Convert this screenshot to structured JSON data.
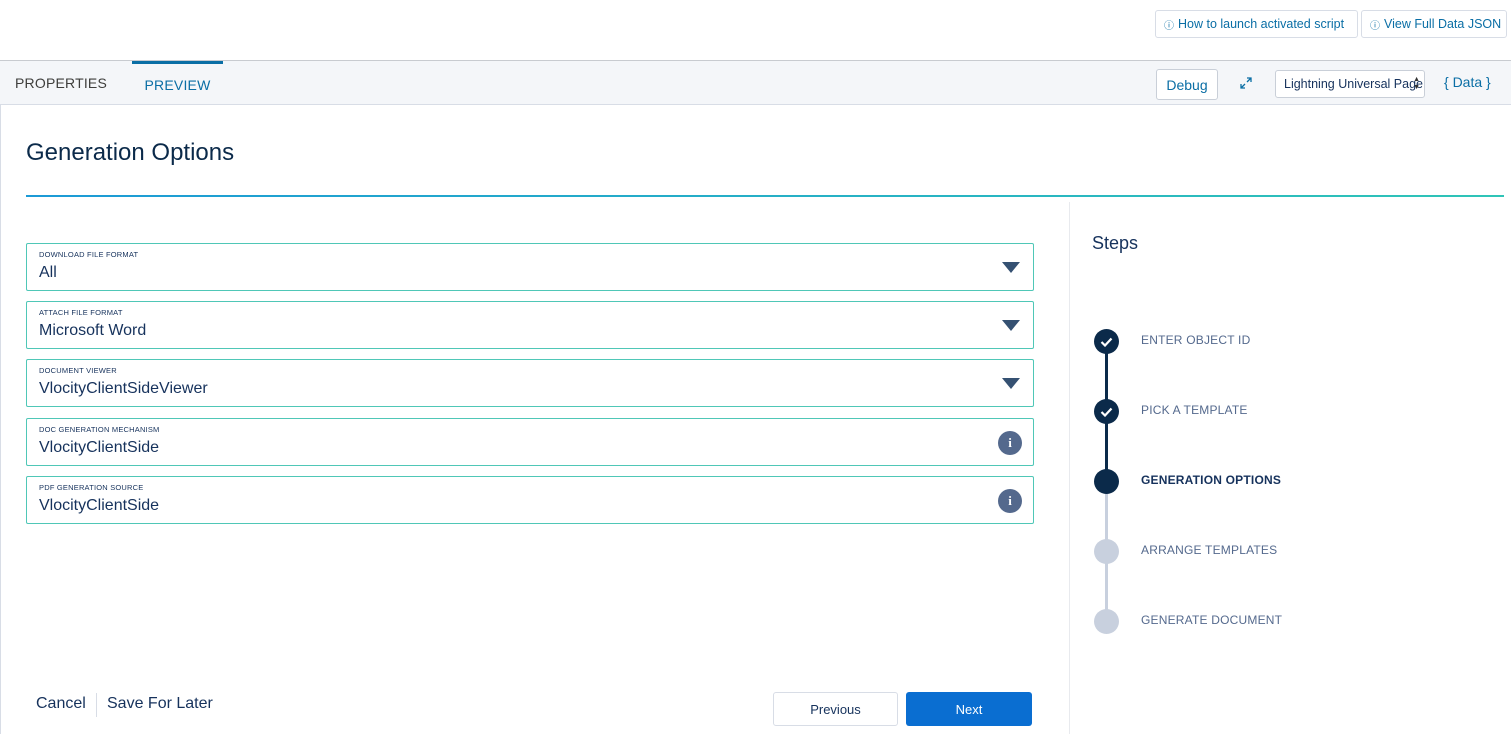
{
  "topbar": {
    "launch_label": "How to launch activated script",
    "json_label": "View Full Data JSON"
  },
  "tabs": [
    {
      "label": "PROPERTIES"
    },
    {
      "label": "PREVIEW"
    }
  ],
  "toolbar": {
    "debug_label": "Debug",
    "layout_select_value": "Lightning Universal Page",
    "data_label": "{ Data }"
  },
  "page": {
    "title": "Generation Options"
  },
  "fields": [
    {
      "label": "DOWNLOAD FILE FORMAT",
      "value": "All",
      "control": "dropdown"
    },
    {
      "label": "ATTACH FILE FORMAT",
      "value": "Microsoft Word",
      "control": "dropdown"
    },
    {
      "label": "DOCUMENT VIEWER",
      "value": "VlocityClientSideViewer",
      "control": "dropdown"
    },
    {
      "label": "DOC GENERATION MECHANISM",
      "value": "VlocityClientSide",
      "control": "info"
    },
    {
      "label": "PDF GENERATION SOURCE",
      "value": "VlocityClientSide",
      "control": "info"
    }
  ],
  "footer": {
    "cancel_label": "Cancel",
    "save_later_label": "Save For Later",
    "previous_label": "Previous",
    "next_label": "Next"
  },
  "steps": {
    "title": "Steps",
    "items": [
      {
        "label": "ENTER OBJECT ID",
        "status": "complete"
      },
      {
        "label": "PICK A TEMPLATE",
        "status": "complete"
      },
      {
        "label": "GENERATION OPTIONS",
        "status": "active"
      },
      {
        "label": "ARRANGE TEMPLATES",
        "status": "pending"
      },
      {
        "label": "GENERATE DOCUMENT",
        "status": "pending"
      }
    ]
  },
  "colors": {
    "complete": "#0b2a4a",
    "active": "#0b2a4a",
    "pending": "#c8d0de",
    "accent": "#0a6ed1"
  }
}
